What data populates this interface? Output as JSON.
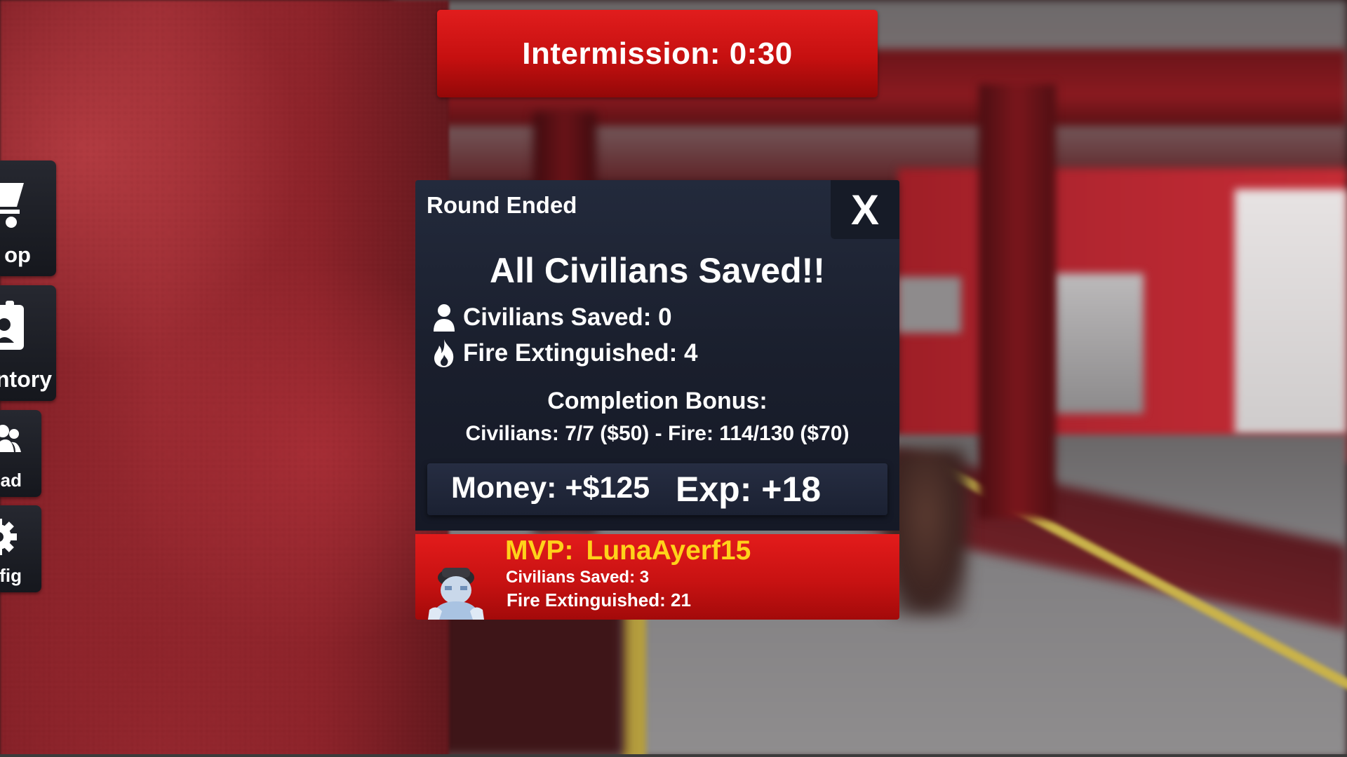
{
  "timer": {
    "text": "Intermission: 0:30"
  },
  "side_menu": {
    "shop_label": "op",
    "inventory_label": "ntory",
    "squad_label": "uad",
    "config_label": "nfig"
  },
  "round_panel": {
    "title": "Round Ended",
    "close_label": "X",
    "headline": "All Civilians Saved!!",
    "civilians_saved": "Civilians Saved: 0",
    "fire_extinguished": "Fire Extinguished: 4",
    "completion_bonus_title": "Completion Bonus:",
    "completion_bonus_detail": "Civilians: 7/7 ($50) - Fire: 114/130 ($70)",
    "money": "Money: +$125",
    "exp": "Exp: +18"
  },
  "mvp": {
    "label": "MVP:",
    "player": "LunaAyerf15",
    "civilians_saved": "Civilians Saved: 3",
    "fire_extinguished": "Fire Extinguished: 21"
  },
  "colors": {
    "timer_red": "#c61010",
    "panel_navy": "#1a1f2d",
    "mvp_red": "#c81212",
    "mvp_gold": "#ffd21a"
  },
  "icons": {
    "shop": "cart-icon",
    "inventory": "id-card-icon",
    "squad": "users-icon",
    "config": "gear-icon",
    "civilians": "person-icon",
    "fire": "flame-icon"
  }
}
